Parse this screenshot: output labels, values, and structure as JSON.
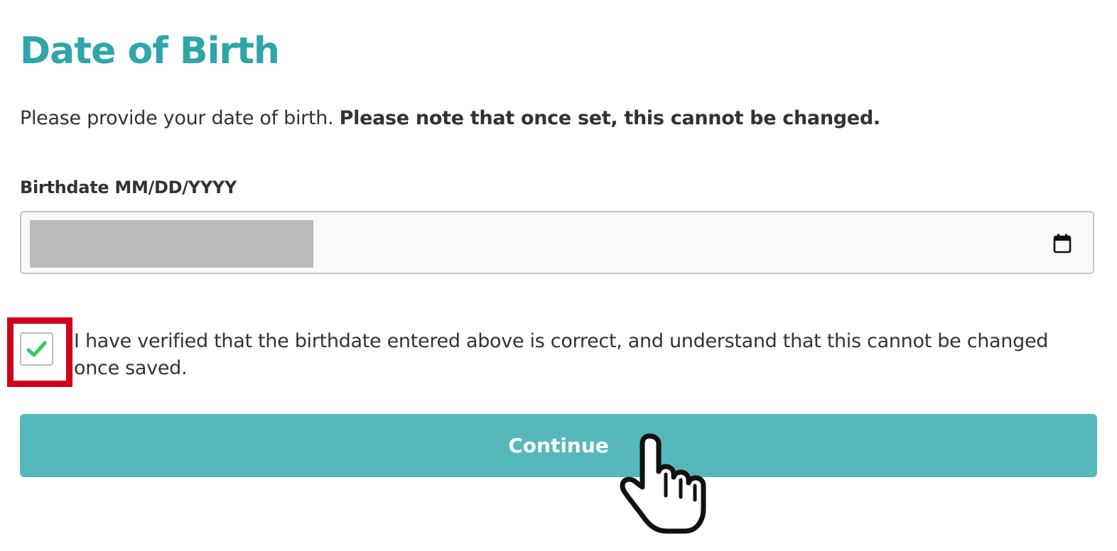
{
  "page": {
    "title": "Date of Birth",
    "intro_text": "Please provide your date of birth. ",
    "intro_emphasis": "Please note that once set, this cannot be changed."
  },
  "birthdate": {
    "label": "Birthdate MM/DD/YYYY",
    "value_redacted": true
  },
  "verification": {
    "checked": true,
    "text": "I have verified that the birthdate entered above is correct, and understand that this cannot be changed once saved."
  },
  "actions": {
    "continue_label": "Continue"
  },
  "colors": {
    "title": "#2fa6a8",
    "button": "#56b8ba",
    "checkmark": "#2ecc58",
    "highlight": "#d0021b"
  },
  "icons": {
    "calendar": "calendar-icon",
    "check": "checkmark-icon",
    "cursor": "hand-pointer-cursor"
  }
}
